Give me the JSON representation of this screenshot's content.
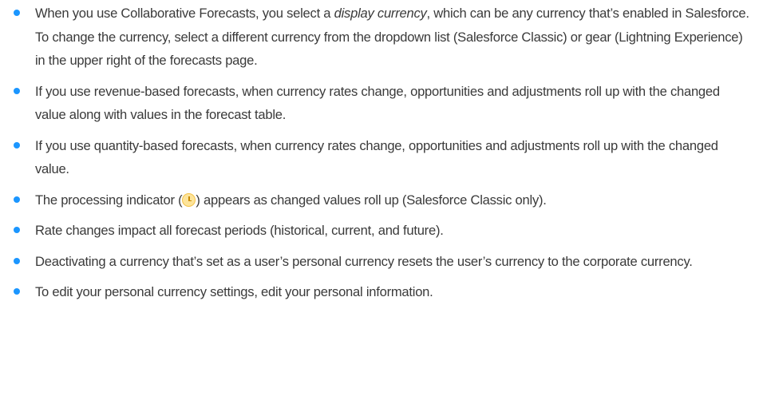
{
  "bullets": [
    {
      "before": "When you use Collaborative Forecasts, you select a ",
      "emphasis": "display currency",
      "after": ", which can be any currency that’s enabled in Salesforce. To change the currency, select a different currency from the dropdown list (Salesforce Classic) or gear (Lightning Experience) in the upper right of the forecasts page."
    },
    {
      "text": "If you use revenue-based forecasts, when currency rates change, opportunities and adjustments roll up with the changed value along with values in the forecast table."
    },
    {
      "text": "If you use quantity-based forecasts, when currency rates change, opportunities and adjustments roll up with the changed value."
    },
    {
      "before": "The processing indicator (",
      "icon": "clock-icon",
      "after": ") appears as changed values roll up (Salesforce Classic only)."
    },
    {
      "text": "Rate changes impact all forecast periods (historical, current, and future)."
    },
    {
      "text": "Deactivating a currency that’s set as a user’s personal currency resets the user’s currency to the corporate currency."
    },
    {
      "text": "To edit your personal currency settings, edit your personal information."
    }
  ],
  "colors": {
    "bullet": "#1b96ff",
    "text": "#3a3a3a",
    "icon_fill": "#fde49a"
  }
}
